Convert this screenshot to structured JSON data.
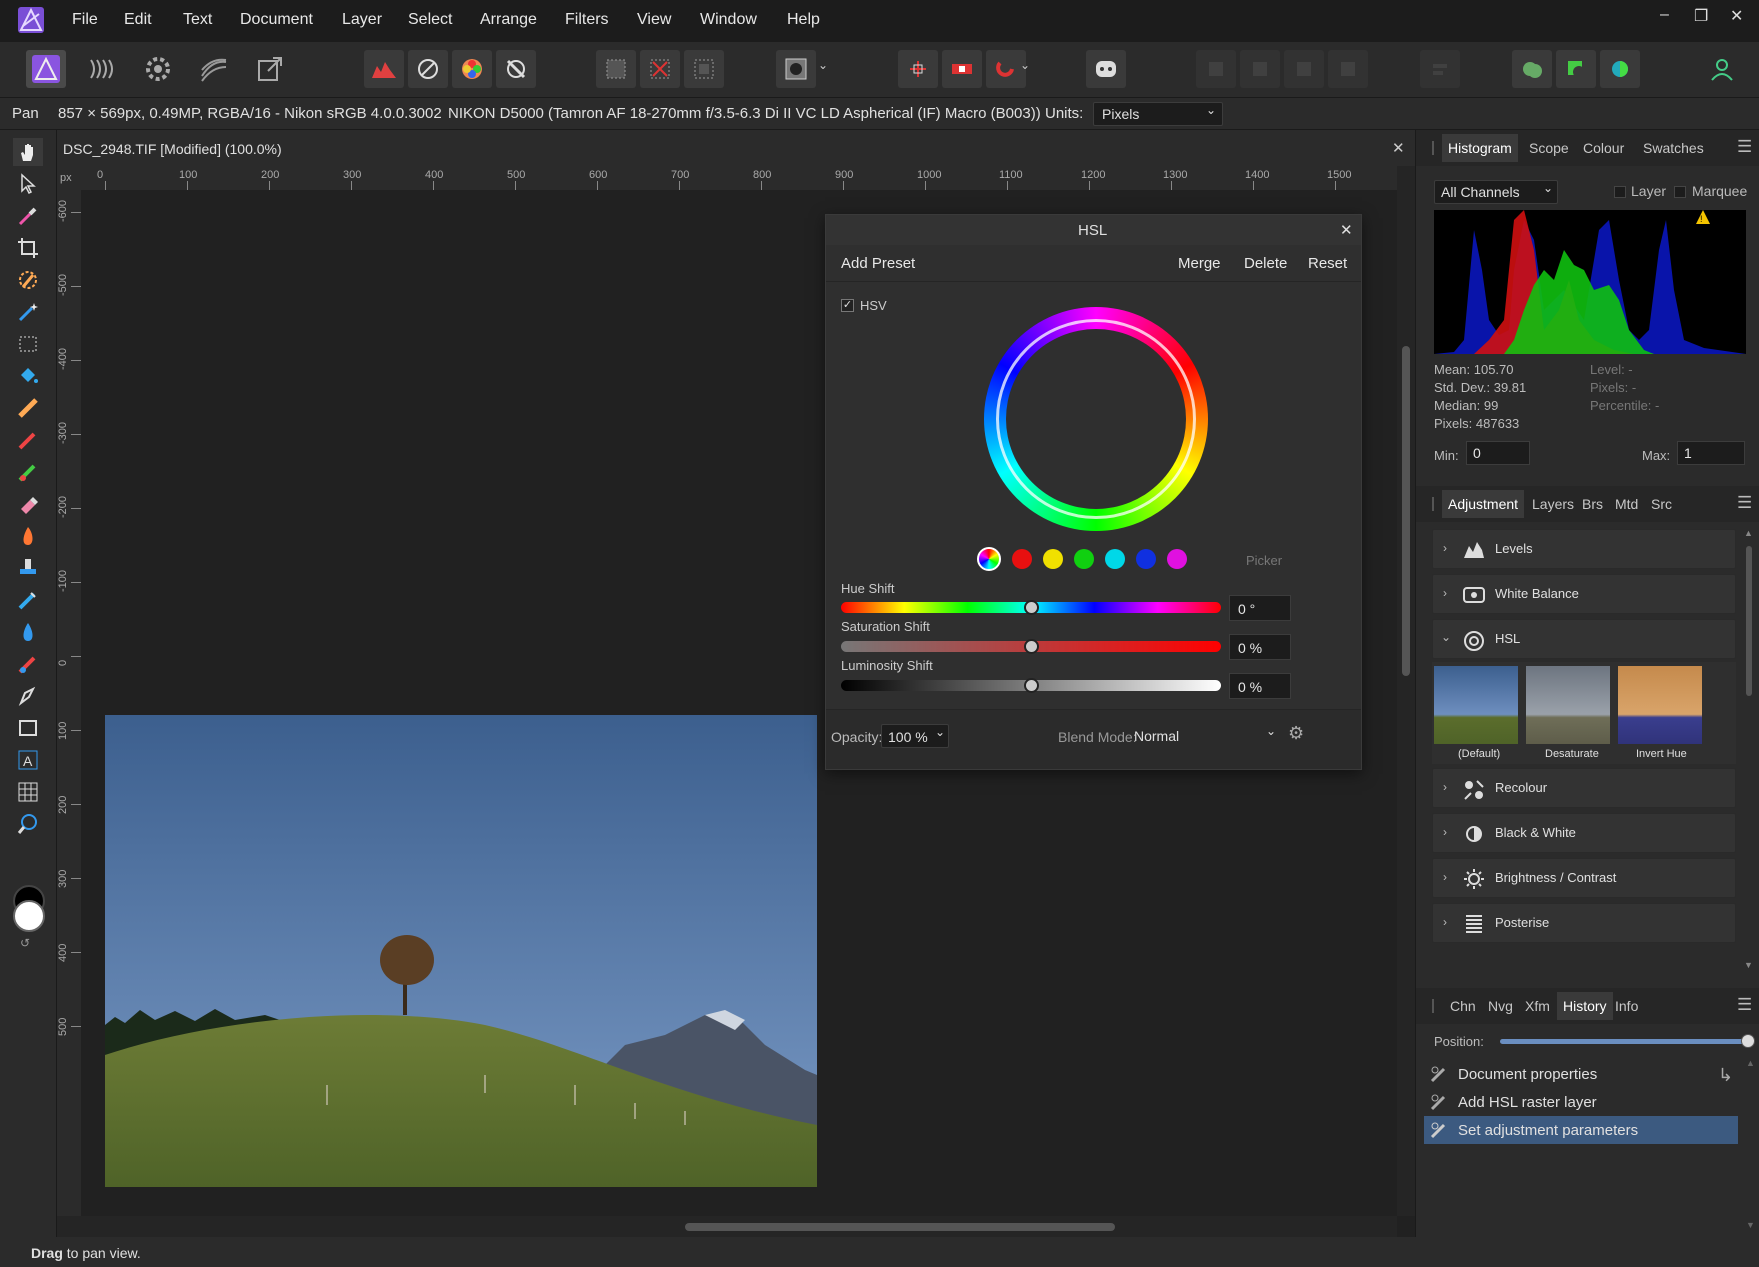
{
  "menubar": {
    "items": [
      "File",
      "Edit",
      "Text",
      "Document",
      "Layer",
      "Select",
      "Arrange",
      "Filters",
      "View",
      "Window",
      "Help"
    ],
    "win_min": "–",
    "win_max": "❐",
    "win_close": "✕"
  },
  "context": {
    "tool": "Pan",
    "doc_info": "857 × 569px, 0.49MP, RGBA/16 - Nikon sRGB 4.0.0.3002",
    "camera": "NIKON D5000 (Tamron AF 18-270mm f/3.5-6.3 Di II VC LD Aspherical (IF) Macro (B003))",
    "units_label": "Units:",
    "units_value": "Pixels"
  },
  "document": {
    "tab_title": "DSC_2948.TIF [Modified] (100.0%)",
    "close": "✕",
    "ruler_unit": "px",
    "hruler": [
      "0",
      "100",
      "200",
      "300",
      "400",
      "500",
      "600",
      "700",
      "800",
      "900",
      "1000",
      "1100",
      "1200",
      "1300",
      "1400",
      "1500"
    ],
    "vruler": [
      "-600",
      "-500",
      "-400",
      "-300",
      "-200",
      "-100",
      "0",
      "100",
      "200",
      "300",
      "400",
      "500"
    ]
  },
  "hsl": {
    "title": "HSL",
    "close": "✕",
    "add_preset": "Add Preset",
    "merge": "Merge",
    "delete": "Delete",
    "reset": "Reset",
    "hsv_label": "HSV",
    "hsv_checked": true,
    "picker": "Picker",
    "swatches": [
      "#e81010",
      "#f0e000",
      "#10d010",
      "#00d8e8",
      "#1030e0",
      "#e010e0"
    ],
    "hue_label": "Hue Shift",
    "hue_value": "0 °",
    "hue_pos": 0.5,
    "sat_label": "Saturation Shift",
    "sat_value": "0 %",
    "sat_pos": 0.5,
    "lum_label": "Luminosity Shift",
    "lum_value": "0 %",
    "lum_pos": 0.5,
    "opacity_label": "Opacity:",
    "opacity_value": "100 %",
    "blend_label": "Blend Mode:",
    "blend_value": "Normal"
  },
  "histogram_panel": {
    "tabs": [
      "Histogram",
      "Scope",
      "Colour",
      "Swatches"
    ],
    "channel": "All Channels",
    "layer_label": "Layer",
    "marquee_label": "Marquee",
    "mean": "Mean: 105.70",
    "std": "Std. Dev.: 39.81",
    "median": "Median: 99",
    "pixels": "Pixels: 487633",
    "level": "Level: -",
    "pixels2": "Pixels: -",
    "percentile": "Percentile: -",
    "min_label": "Min:",
    "min_value": "0",
    "max_label": "Max:",
    "max_value": "1"
  },
  "adjustment_panel": {
    "tabs": [
      "Adjustment",
      "Layers",
      "Brs",
      "Mtd",
      "Src"
    ],
    "items": [
      {
        "label": "Levels",
        "expanded": false
      },
      {
        "label": "White Balance",
        "expanded": false
      },
      {
        "label": "HSL",
        "expanded": true
      },
      {
        "label": "Recolour",
        "expanded": false
      },
      {
        "label": "Black & White",
        "expanded": false
      },
      {
        "label": "Brightness / Contrast",
        "expanded": false
      },
      {
        "label": "Posterise",
        "expanded": false
      }
    ],
    "presets": [
      "(Default)",
      "Desaturate",
      "Invert Hue"
    ]
  },
  "history_panel": {
    "tabs": [
      "Chn",
      "Nvg",
      "Xfm",
      "History",
      "Info"
    ],
    "position_label": "Position:",
    "position": 1.0,
    "items": [
      "Document properties",
      "Add HSL raster layer",
      "Set adjustment parameters"
    ],
    "selected_index": 2
  },
  "status": {
    "bold": "Drag",
    "text": " to pan view."
  },
  "colors": {
    "accent": "#3c5a80",
    "bg": "#1e1e1e",
    "panel": "#2b2b2b"
  }
}
